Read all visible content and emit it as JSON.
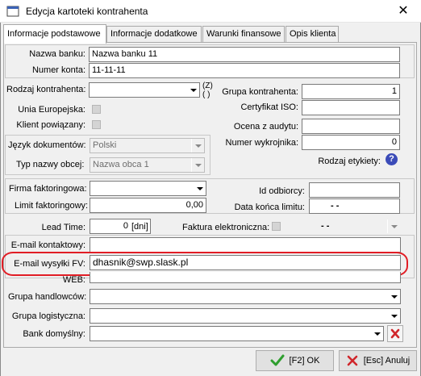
{
  "window": {
    "title": "Edycja kartoteki kontrahenta",
    "close_glyph": "✕"
  },
  "tabs": [
    "Informacje podstawowe",
    "Informacje dodatkowe",
    "Warunki finansowe",
    "Opis klienta"
  ],
  "bank": {
    "name_label": "Nazwa banku:",
    "name_value": "Nazwa banku 11",
    "account_label": "Numer konta:",
    "account_value": "11-11-11"
  },
  "left_col": {
    "rodzaj_label": "Rodzaj kontrahenta:",
    "rodzaj_value": "",
    "z_marker": "(Z)",
    "paren_marker": "( )",
    "unia_label": "Unia Europejska:",
    "klient_label": "Klient powiązany:",
    "jezyk_label": "Język dokumentów:",
    "jezyk_value": "Polski",
    "typ_label": "Typ nazwy obcej:",
    "typ_value": "Nazwa obca 1"
  },
  "right_col": {
    "grupa_label": "Grupa kontrahenta:",
    "grupa_value": "1",
    "cert_label": "Certyfikat ISO:",
    "cert_value": "",
    "ocena_label": "Ocena z audytu:",
    "ocena_value": "",
    "wykrojnik_label": "Numer wykrojnika:",
    "wykrojnik_value": "0",
    "etykiety_label": "Rodzaj etykiety:",
    "help_glyph": "?"
  },
  "factoring": {
    "firma_label": "Firma faktoringowa:",
    "firma_value": "",
    "limit_label": "Limit faktoringowy:",
    "limit_value": "0,00",
    "id_label": "Id odbiorcy:",
    "id_value": "",
    "data_label": "Data końca limitu:",
    "data_value": " -  - "
  },
  "misc": {
    "lead_label": "Lead Time:",
    "lead_value": "0",
    "lead_unit": "[dni]",
    "faktura_label": "Faktura elektroniczna:",
    "faktura_value": " -  - ",
    "email_kontakt_label": "E-mail kontaktowy:",
    "email_kontakt_value": "",
    "email_fv_label": "E-mail wysyłki FV:",
    "email_fv_value": "dhasnik@swp.slask.pl",
    "www_label": "WEB:",
    "www_value": "",
    "handlowcow_label": "Grupa handlowców:",
    "logistyczna_label": "Grupa logistyczna:",
    "bank_label": "Bank domyślny:",
    "bank_value": ""
  },
  "buttons": {
    "ok": "[F2] OK",
    "cancel": "[Esc] Anuluj"
  },
  "colors": {
    "highlight": "#e11d25",
    "ok_check": "#2e9e2e",
    "cancel_x": "#d0262b",
    "help": "#3b4bb8"
  }
}
